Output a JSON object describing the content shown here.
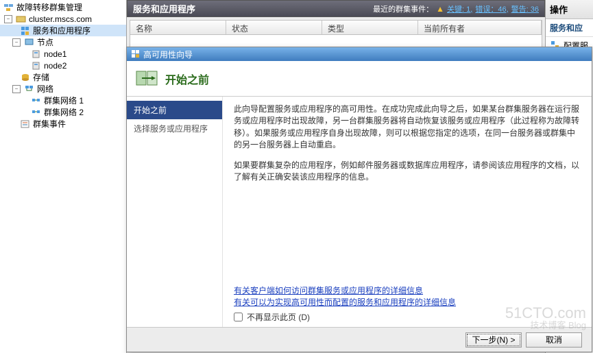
{
  "tree": {
    "root": "故障转移群集管理",
    "cluster": "cluster.mscs.com",
    "services_apps": "服务和应用程序",
    "nodes": "节点",
    "node1": "node1",
    "node2": "node2",
    "storage": "存储",
    "networks": "网络",
    "net1": "群集网络 1",
    "net2": "群集网络 2",
    "events": "群集事件"
  },
  "main": {
    "header_title": "服务和应用程序",
    "recent_events_label": "最近的群集事件：",
    "link_critical": "关键: 1,",
    "link_error": "错误：46,",
    "link_warning": "警告: 36",
    "col_name": "名称",
    "col_state": "状态",
    "col_type": "类型",
    "col_owner": "当前所有者"
  },
  "actions": {
    "header": "操作",
    "subhead": "服务和应",
    "configure": "配置服"
  },
  "wizard": {
    "title": "高可用性向导",
    "heading": "开始之前",
    "nav_step1": "开始之前",
    "nav_step2": "选择服务或应用程序",
    "para1": "此向导配置服务或应用程序的高可用性。在成功完成此向导之后，如果某台群集服务器在运行服务或应用程序时出现故障，另一台群集服务器将自动恢复该服务或应用程序（此过程称为故障转移）。如果服务或应用程序自身出现故障，则可以根据您指定的选项，在同一台服务器或群集中的另一台服务器上自动重启。",
    "para2": "如果要群集复杂的应用程序，例如邮件服务器或数据库应用程序，请参阅该应用程序的文档，以了解有关正确安装该应用程序的信息。",
    "link1": "有关客户端如何访问群集服务或应用程序的详细信息",
    "link2": "有关可以为实现高可用性而配置的服务和应用程序的详细信息",
    "checkbox_label": "不再显示此页 (D)",
    "btn_next": "下一步(N) >",
    "btn_cancel": "取消"
  },
  "watermark": {
    "line1": "51CTO.com",
    "line2": "技术博客 Blog"
  }
}
